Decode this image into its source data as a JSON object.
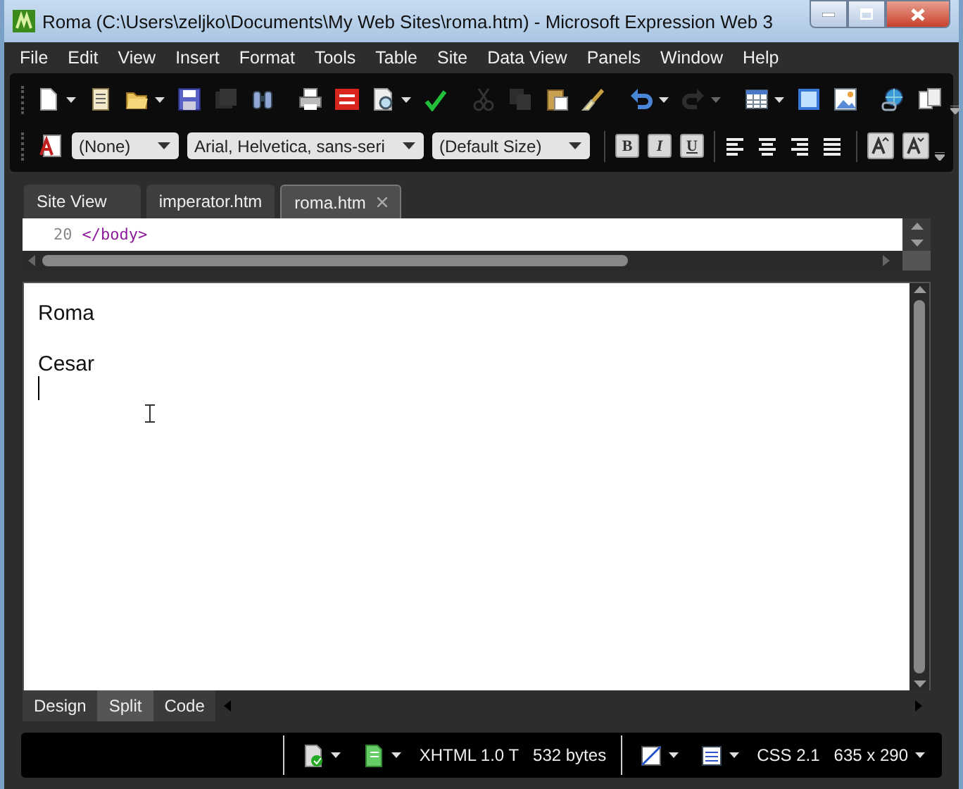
{
  "window": {
    "title": "Roma (C:\\Users\\zeljko\\Documents\\My Web Sites\\roma.htm) - Microsoft Expression Web 3"
  },
  "menu": [
    "File",
    "Edit",
    "View",
    "Insert",
    "Format",
    "Tools",
    "Table",
    "Site",
    "Data View",
    "Panels",
    "Window",
    "Help"
  ],
  "toolbar_common": [
    {
      "kind": "new-page",
      "disabled": false,
      "dropdown": true
    },
    {
      "kind": "page-list",
      "disabled": false,
      "dropdown": false
    },
    {
      "kind": "open-folder",
      "disabled": false,
      "dropdown": true
    },
    {
      "kind": "save",
      "disabled": false,
      "dropdown": false
    },
    {
      "kind": "save-all",
      "disabled": true,
      "dropdown": false
    },
    {
      "kind": "find",
      "disabled": false,
      "dropdown": false
    },
    {
      "kind": "sep"
    },
    {
      "kind": "print",
      "disabled": false,
      "dropdown": false
    },
    {
      "kind": "sharepoint",
      "disabled": false,
      "dropdown": false
    },
    {
      "kind": "preview",
      "disabled": false,
      "dropdown": true
    },
    {
      "kind": "spelling",
      "disabled": false,
      "dropdown": false
    },
    {
      "kind": "sep"
    },
    {
      "kind": "cut",
      "disabled": true,
      "dropdown": false
    },
    {
      "kind": "copy",
      "disabled": true,
      "dropdown": false
    },
    {
      "kind": "paste",
      "disabled": false,
      "dropdown": false
    },
    {
      "kind": "brush",
      "disabled": false,
      "dropdown": false
    },
    {
      "kind": "sep"
    },
    {
      "kind": "undo",
      "disabled": false,
      "dropdown": true
    },
    {
      "kind": "redo",
      "disabled": true,
      "dropdown": true
    },
    {
      "kind": "sep"
    },
    {
      "kind": "table",
      "disabled": false,
      "dropdown": true
    },
    {
      "kind": "layer",
      "disabled": false,
      "dropdown": false
    },
    {
      "kind": "picture",
      "disabled": false,
      "dropdown": false
    },
    {
      "kind": "sep"
    },
    {
      "kind": "hyperlink",
      "disabled": false,
      "dropdown": false
    },
    {
      "kind": "pages",
      "disabled": false,
      "dropdown": false
    }
  ],
  "toolbar_formatting": {
    "style_select": "(None)",
    "font_select": "Arial, Helvetica, sans-seri",
    "size_select": "(Default Size)",
    "style_buttons": [
      {
        "label": "B",
        "kind": "bold"
      },
      {
        "label": "I",
        "kind": "italic"
      },
      {
        "label": "U",
        "kind": "underline"
      }
    ],
    "align_buttons": [
      {
        "kind": "left"
      },
      {
        "kind": "center"
      },
      {
        "kind": "right"
      },
      {
        "kind": "justify"
      }
    ]
  },
  "tabs": [
    {
      "label": "Site View",
      "selected": false,
      "closable": false
    },
    {
      "label": "imperator.htm",
      "selected": false,
      "closable": false
    },
    {
      "label": "roma.htm",
      "selected": true,
      "closable": true
    }
  ],
  "code_view": {
    "line_number": "20",
    "code": "</body>"
  },
  "design_view": {
    "paragraphs": [
      "Roma",
      "Cesar"
    ]
  },
  "view_tabs": [
    {
      "label": "Design",
      "selected": false
    },
    {
      "label": "Split",
      "selected": true
    },
    {
      "label": "Code",
      "selected": false
    }
  ],
  "status_bar": {
    "doctype": "XHTML 1.0 T",
    "size": "532 bytes",
    "css": "CSS 2.1",
    "dimensions": "635 x 290"
  }
}
